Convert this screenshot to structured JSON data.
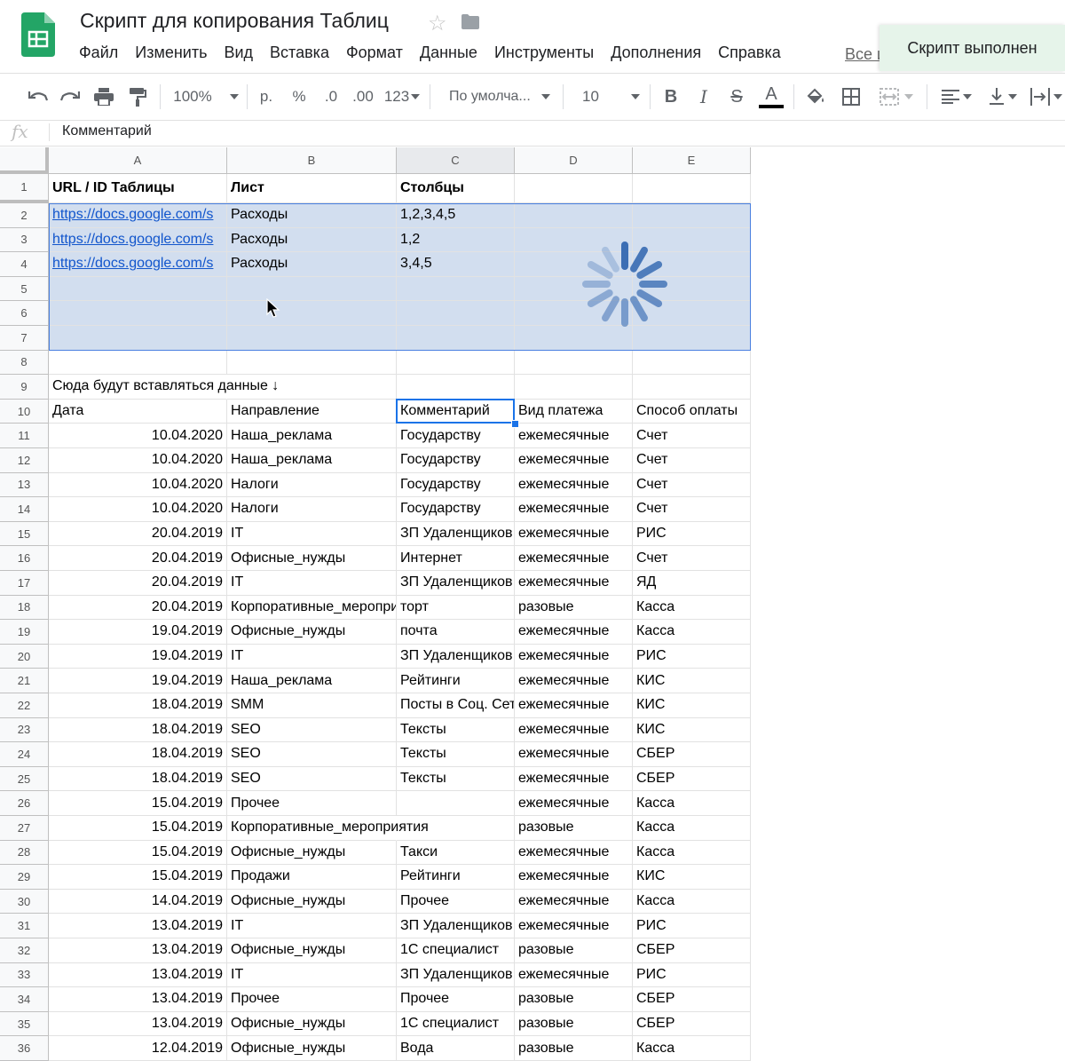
{
  "app": {
    "title": "Скрипт для копирования Таблиц",
    "menu": [
      "Файл",
      "Изменить",
      "Вид",
      "Вставка",
      "Формат",
      "Данные",
      "Инструменты",
      "Дополнения",
      "Справка"
    ],
    "all_changes": "Все и",
    "toast": "Скрипт выполнен"
  },
  "toolbar": {
    "zoom": "100%",
    "currency": "р.",
    "percent": "%",
    "dec_decrease": ".0",
    "dec_increase": ".00",
    "format_more": "123",
    "font": "По умолча...",
    "font_size": "10",
    "bold": "B",
    "italic": "I",
    "strike": "S",
    "text_color_letter": "A"
  },
  "formula": {
    "fx": "fx",
    "value": "Комментарий"
  },
  "columns": [
    "A",
    "B",
    "C",
    "D",
    "E"
  ],
  "row_numbers": [
    "1",
    "2",
    "3",
    "4",
    "5",
    "6",
    "7",
    "8",
    "9",
    "10",
    "11",
    "12",
    "13",
    "14",
    "15",
    "16",
    "17",
    "18",
    "19",
    "20",
    "21",
    "22",
    "23",
    "24",
    "25",
    "26",
    "27",
    "28",
    "29",
    "30",
    "31",
    "32",
    "33",
    "34",
    "35",
    "36"
  ],
  "rows": [
    [
      "URL / ID Таблицы",
      "Лист",
      "Столбцы",
      "",
      ""
    ],
    [
      "https://docs.google.com/s",
      "Расходы",
      "1,2,3,4,5",
      "",
      ""
    ],
    [
      "https://docs.google.com/s",
      "Расходы",
      "1,2",
      "",
      ""
    ],
    [
      "https://docs.google.com/s",
      "Расходы",
      "3,4,5",
      "",
      ""
    ],
    [
      "",
      "",
      "",
      "",
      ""
    ],
    [
      "",
      "",
      "",
      "",
      ""
    ],
    [
      "",
      "",
      "",
      "",
      ""
    ],
    [
      "",
      "",
      "",
      "",
      ""
    ],
    [
      "Сюда будут вставляться данные ↓",
      "",
      "",
      "",
      ""
    ],
    [
      "Дата",
      "Направление",
      "Комментарий",
      "Вид платежа",
      "Способ оплаты"
    ],
    [
      "10.04.2020",
      "Наша_реклама",
      "Государству",
      "ежемесячные",
      "Счет"
    ],
    [
      "10.04.2020",
      "Наша_реклама",
      "Государству",
      "ежемесячные",
      "Счет"
    ],
    [
      "10.04.2020",
      "Налоги",
      "Государству",
      "ежемесячные",
      "Счет"
    ],
    [
      "10.04.2020",
      "Налоги",
      "Государству",
      "ежемесячные",
      "Счет"
    ],
    [
      "20.04.2019",
      "IT",
      "ЗП Удаленщиков",
      "ежемесячные",
      "РИС"
    ],
    [
      "20.04.2019",
      "Офисные_нужды",
      "Интернет",
      "ежемесячные",
      "Счет"
    ],
    [
      "20.04.2019",
      "IT",
      "ЗП Удаленщиков",
      "ежемесячные",
      "ЯД"
    ],
    [
      "20.04.2019",
      "Корпоративные_мероприятия",
      "торт",
      "разовые",
      "Касса"
    ],
    [
      "19.04.2019",
      "Офисные_нужды",
      "почта",
      "ежемесячные",
      "Касса"
    ],
    [
      "19.04.2019",
      "IT",
      "ЗП Удаленщиков",
      "ежемесячные",
      "РИС"
    ],
    [
      "19.04.2019",
      "Наша_реклама",
      "Рейтинги",
      "ежемесячные",
      "КИС"
    ],
    [
      "18.04.2019",
      "SMM",
      "Посты в Соц. Сетях",
      "ежемесячные",
      "КИС"
    ],
    [
      "18.04.2019",
      "SEO",
      "Тексты",
      "ежемесячные",
      "КИС"
    ],
    [
      "18.04.2019",
      "SEO",
      "Тексты",
      "ежемесячные",
      "СБЕР"
    ],
    [
      "18.04.2019",
      "SEO",
      "Тексты",
      "ежемесячные",
      "СБЕР"
    ],
    [
      "15.04.2019",
      "Прочее",
      "",
      "ежемесячные",
      "Касса"
    ],
    [
      "15.04.2019",
      "Корпоративные_мероприятия",
      "",
      "разовые",
      "Касса"
    ],
    [
      "15.04.2019",
      "Офисные_нужды",
      "Такси",
      "ежемесячные",
      "Касса"
    ],
    [
      "15.04.2019",
      "Продажи",
      "Рейтинги",
      "ежемесячные",
      "КИС"
    ],
    [
      "14.04.2019",
      "Офисные_нужды",
      "Прочее",
      "ежемесячные",
      "Касса"
    ],
    [
      "13.04.2019",
      "IT",
      "ЗП Удаленщиков",
      "ежемесячные",
      "РИС"
    ],
    [
      "13.04.2019",
      "Офисные_нужды",
      "1С специалист",
      "разовые",
      "СБЕР"
    ],
    [
      "13.04.2019",
      "IT",
      "ЗП Удаленщиков",
      "ежемесячные",
      "РИС"
    ],
    [
      "13.04.2019",
      "Прочее",
      "Прочее",
      "разовые",
      "СБЕР"
    ],
    [
      "13.04.2019",
      "Офисные_нужды",
      "1С специалист",
      "разовые",
      "СБЕР"
    ],
    [
      "12.04.2019",
      "Офисные_нужды",
      "Вода",
      "разовые",
      "Касса"
    ]
  ],
  "colors": {
    "selection": "#d2deef",
    "active_border": "#1a73e8",
    "link": "#1155cc",
    "toast_bg": "#e6f4ea",
    "sheets_green": "#0f9d58"
  }
}
